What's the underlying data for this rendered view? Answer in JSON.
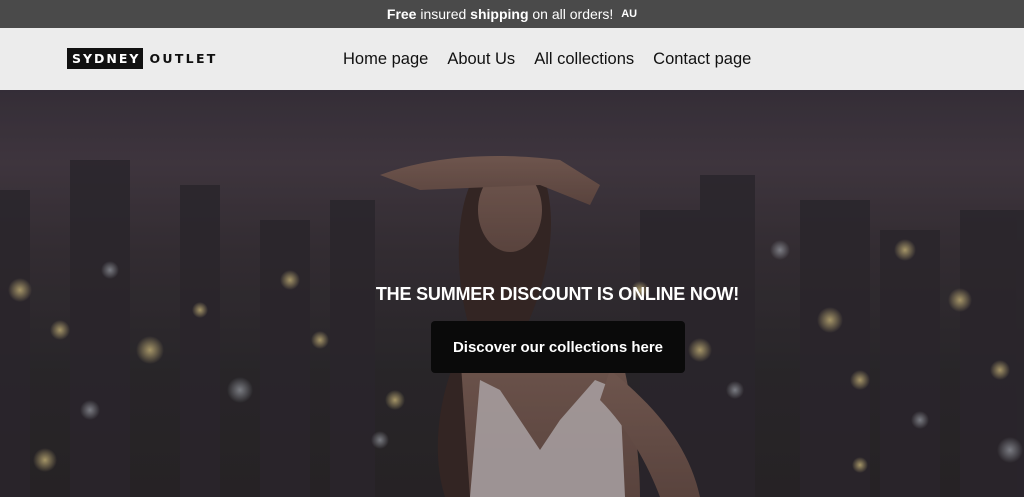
{
  "announcement": {
    "part1_bold": "Free",
    "part2": " insured ",
    "part3_bold": "shipping",
    "part4": " on all orders! ",
    "country": "AU"
  },
  "header": {
    "logo_left": "SYDNEY",
    "logo_right": "OUTLET",
    "nav": [
      "Home page",
      "About Us",
      "All collections",
      "Contact page"
    ]
  },
  "hero": {
    "headline": "THE SUMMER DISCOUNT IS ONLINE NOW!",
    "cta_label": "Discover our collections here"
  },
  "colors": {
    "announcement_bg": "#4a4a4a",
    "header_bg": "#ececec",
    "cta_bg": "#0a0a0a"
  }
}
